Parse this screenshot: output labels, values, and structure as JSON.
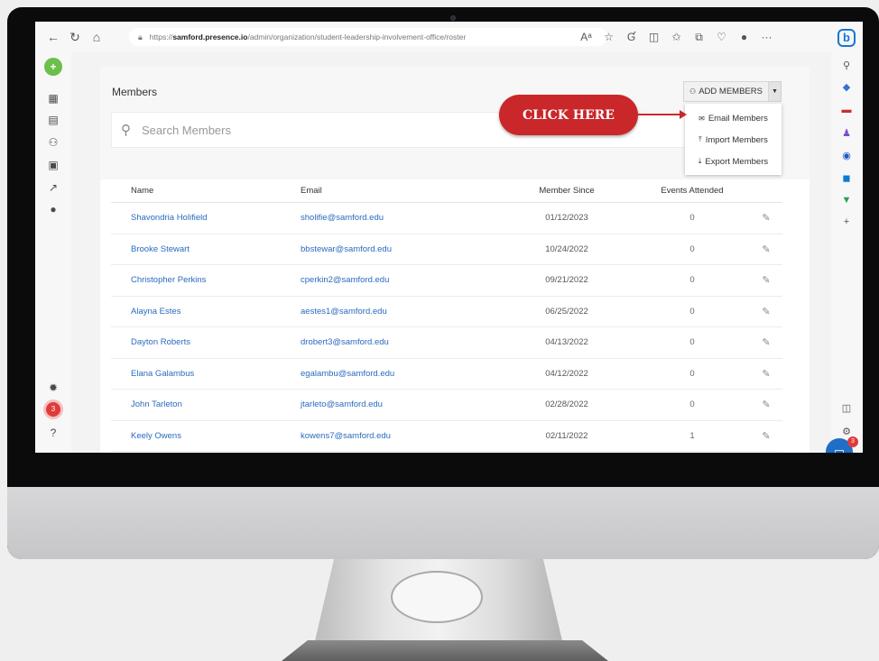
{
  "browser": {
    "url_prefix": "https://",
    "url_host": "samford.presence.io",
    "url_path": "/admin/organization/student-leadership-involvement-office/roster",
    "bing_label": "b"
  },
  "left_rail": {
    "notif_count": "3"
  },
  "members": {
    "title": "Members",
    "search_placeholder": "Search Members",
    "add_label": "ADD MEMBERS",
    "dropdown": [
      "Email Members",
      "Import Members",
      "Export Members"
    ]
  },
  "callout": {
    "text": "CLICK HERE"
  },
  "table": {
    "headers": [
      "Name",
      "Email",
      "Member Since",
      "Events Attended"
    ],
    "rows": [
      {
        "name": "Shavondria Holifield",
        "email": "sholifie@samford.edu",
        "since": "01/12/2023",
        "events": "0"
      },
      {
        "name": "Brooke Stewart",
        "email": "bbstewar@samford.edu",
        "since": "10/24/2022",
        "events": "0"
      },
      {
        "name": "Christopher Perkins",
        "email": "cperkin2@samford.edu",
        "since": "09/21/2022",
        "events": "0"
      },
      {
        "name": "Alayna Estes",
        "email": "aestes1@samford.edu",
        "since": "06/25/2022",
        "events": "0"
      },
      {
        "name": "Dayton Roberts",
        "email": "drobert3@samford.edu",
        "since": "04/13/2022",
        "events": "0"
      },
      {
        "name": "Elana Galambus",
        "email": "egalambu@samford.edu",
        "since": "04/12/2022",
        "events": "0"
      },
      {
        "name": "John Tarleton",
        "email": "jtarleto@samford.edu",
        "since": "02/28/2022",
        "events": "0"
      },
      {
        "name": "Keely Owens",
        "email": "kowens7@samford.edu",
        "since": "02/11/2022",
        "events": "1"
      }
    ]
  },
  "chat": {
    "badge": "3"
  },
  "colors": {
    "accent_red": "#c9272a",
    "link_blue": "#2a6bbf",
    "add_green": "#6bbf4a"
  }
}
